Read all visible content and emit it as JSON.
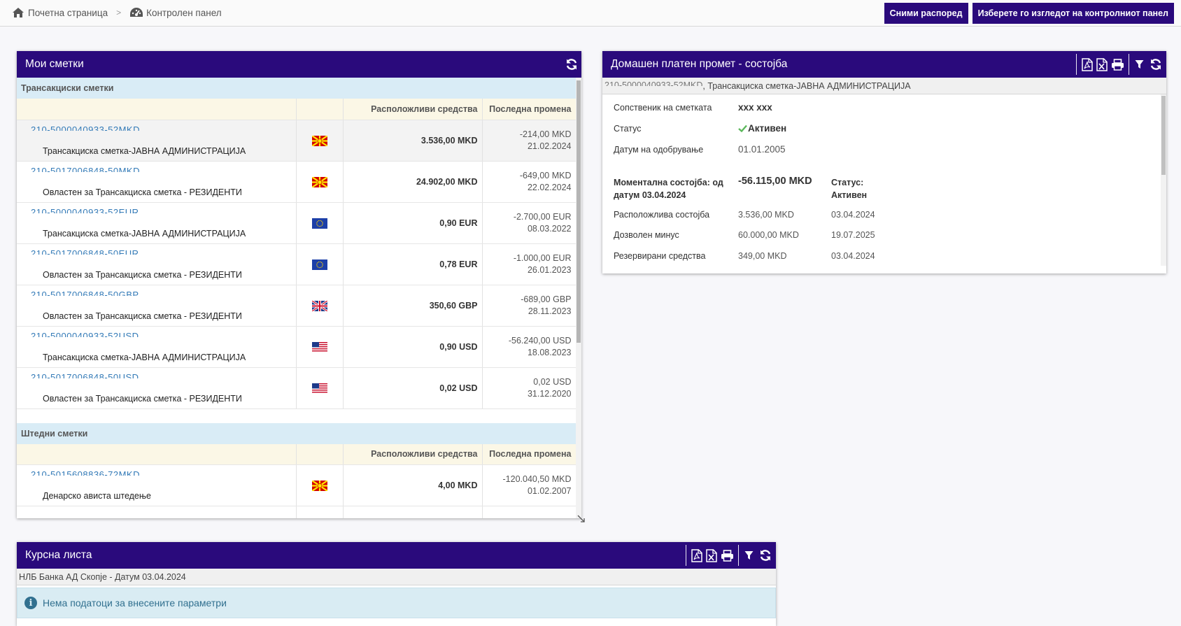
{
  "breadcrumb": {
    "home": "Почетна страница",
    "dashboard": "Контролен панел"
  },
  "top_buttons": {
    "save_layout": "Сними распоред",
    "choose_view": "Изберете го изгледот на контролниот панел"
  },
  "accounts_panel": {
    "title": "Мои сметки",
    "groups": [
      {
        "title": "Трансакциски сметки",
        "header": {
          "available": "Расположливи средства",
          "last_change": "Последна промена"
        },
        "rows": [
          {
            "number": "210-5000040933-52MKD",
            "name": "Трансакциска сметка-ЈАВНА АДМИНИСТРАЦИЈА",
            "flag": "mk-flag",
            "balance": "3.536,00 MKD",
            "change_amount": "-214,00 MKD",
            "change_date": "21.02.2024"
          },
          {
            "number": "210-5017006848-50MKD",
            "name": "Овластен за Трансакциска сметка - РЕЗИДЕНТИ",
            "flag": "mk-flag",
            "balance": "24.902,00 MKD",
            "change_amount": "-649,00 MKD",
            "change_date": "22.02.2024"
          },
          {
            "number": "210-5000040933-52EUR",
            "name": "Трансакциска сметка-ЈАВНА АДМИНИСТРАЦИЈА",
            "flag": "eu-flag",
            "balance": "0,90 EUR",
            "change_amount": "-2.700,00 EUR",
            "change_date": "08.03.2022"
          },
          {
            "number": "210-5017006848-50EUR",
            "name": "Овластен за Трансакциска сметка - РЕЗИДЕНТИ",
            "flag": "eu-flag",
            "balance": "0,78 EUR",
            "change_amount": "-1.000,00 EUR",
            "change_date": "26.01.2023"
          },
          {
            "number": "210-5017006848-50GBP",
            "name": "Овластен за Трансакциска сметка - РЕЗИДЕНТИ",
            "flag": "uk-flag",
            "balance": "350,60 GBP",
            "change_amount": "-689,00 GBP",
            "change_date": "28.11.2023"
          },
          {
            "number": "210-5000040933-52USD",
            "name": "Трансакциска сметка-ЈАВНА АДМИНИСТРАЦИЈА",
            "flag": "us-flag",
            "balance": "0,90 USD",
            "change_amount": "-56.240,00 USD",
            "change_date": "18.08.2023"
          },
          {
            "number": "210-5017006848-50USD",
            "name": "Овластен за Трансакциска сметка - РЕЗИДЕНТИ",
            "flag": "us-flag",
            "balance": "0,02 USD",
            "change_amount": "0,02 USD",
            "change_date": "31.12.2020"
          }
        ]
      },
      {
        "title": "Штедни сметки",
        "header": {
          "available": "Расположливи средства",
          "last_change": "Последна промена"
        },
        "rows": [
          {
            "number": "210-5015608836-72MKD",
            "name": "Денарско ависта штедење",
            "flag": "mk-flag",
            "balance": "4,00 MKD",
            "change_amount": "-120.040,50 MKD",
            "change_date": "01.02.2007"
          }
        ]
      }
    ]
  },
  "domestic_panel": {
    "title": "Домашен платен промет - состојба",
    "account_number": "210-5000040933-52MKD",
    "account_name": ", Трансакциска сметка-ЈАВНА АДМИНИСТРАЦИЈА",
    "owner_label": "Сопственик на сметката",
    "owner_value": "xxx xxx",
    "status_label": "Статус",
    "status_value": "Активен",
    "approval_label": "Датум на одобрување",
    "approval_value": "01.01.2005",
    "current_label": "Моментална состојба: од датум 03.04.2024",
    "current_value": "-56.115,00 MKD",
    "current_status_label": "Статус:",
    "current_status_value": "Активен",
    "available_label": "Расположлива состојба",
    "available_value": "3.536,00 MKD",
    "available_date": "03.04.2024",
    "overdraft_label": "Дозволен минус",
    "overdraft_value": "60.000,00 MKD",
    "overdraft_date": "19.07.2025",
    "reserved_label": "Резервирани средства",
    "reserved_value": "349,00 MKD",
    "reserved_date": "03.04.2024"
  },
  "exchange_panel": {
    "title": "Курсна листа",
    "subtitle": "НЛБ Банка АД Скопје - Датум 03.04.2024",
    "message": "Нема податоци за внесените параметри"
  },
  "colors": {
    "header": "#2a0a7c",
    "link": "#337ab7",
    "group_bg": "#d9ecf6",
    "header_row_bg": "#fbf7e6"
  }
}
